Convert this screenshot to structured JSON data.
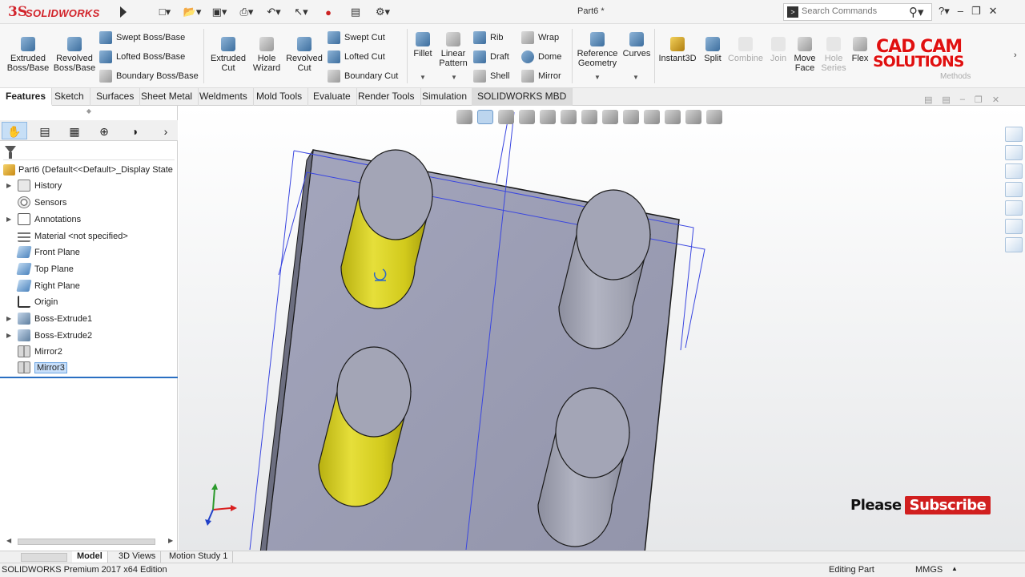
{
  "app": {
    "brand": "SOLIDWORKS",
    "doc_title": "Part6 *",
    "search_placeholder": "Search Commands"
  },
  "ribbon": {
    "big_buttons": [
      {
        "id": "extruded-boss",
        "label": "Extruded Boss/Base"
      },
      {
        "id": "revolved-boss",
        "label": "Revolved Boss/Base"
      },
      {
        "id": "extruded-cut",
        "label": "Extruded Cut"
      },
      {
        "id": "hole-wizard",
        "label": "Hole Wizard"
      },
      {
        "id": "revolved-cut",
        "label": "Revolved Cut"
      },
      {
        "id": "fillet",
        "label": "Fillet"
      },
      {
        "id": "linear-pattern",
        "label": "Linear Pattern"
      },
      {
        "id": "reference-geometry",
        "label": "Reference Geometry"
      },
      {
        "id": "curves",
        "label": "Curves"
      },
      {
        "id": "instant3d",
        "label": "Instant3D"
      },
      {
        "id": "split",
        "label": "Split"
      },
      {
        "id": "combine",
        "label": "Combine"
      },
      {
        "id": "join",
        "label": "Join"
      },
      {
        "id": "move-face",
        "label": "Move Face"
      },
      {
        "id": "hole-series",
        "label": "Hole Series"
      },
      {
        "id": "flex",
        "label": "Flex"
      }
    ],
    "small_buttons": [
      {
        "id": "swept-boss",
        "label": "Swept Boss/Base"
      },
      {
        "id": "lofted-boss",
        "label": "Lofted Boss/Base"
      },
      {
        "id": "boundary-boss",
        "label": "Boundary Boss/Base"
      },
      {
        "id": "swept-cut",
        "label": "Swept Cut"
      },
      {
        "id": "lofted-cut",
        "label": "Lofted Cut"
      },
      {
        "id": "boundary-cut",
        "label": "Boundary Cut"
      },
      {
        "id": "rib",
        "label": "Rib"
      },
      {
        "id": "draft",
        "label": "Draft"
      },
      {
        "id": "shell",
        "label": "Shell"
      },
      {
        "id": "wrap",
        "label": "Wrap"
      },
      {
        "id": "dome",
        "label": "Dome"
      },
      {
        "id": "mirror",
        "label": "Mirror"
      }
    ],
    "methods_label": "Methods"
  },
  "command_tabs": [
    "Features",
    "Sketch",
    "Surfaces",
    "Sheet Metal",
    "Weldments",
    "Mold Tools",
    "Evaluate",
    "Render Tools",
    "Simulation",
    "SOLIDWORKS MBD"
  ],
  "feature_tree": {
    "root": "Part6  (Default<<Default>_Display State",
    "items": [
      {
        "label": "History",
        "icon": "history-icon",
        "expandable": true
      },
      {
        "label": "Sensors",
        "icon": "sensors-icon",
        "expandable": false
      },
      {
        "label": "Annotations",
        "icon": "annotations-icon",
        "expandable": true
      },
      {
        "label": "Material <not specified>",
        "icon": "material-icon",
        "expandable": false
      },
      {
        "label": "Front Plane",
        "icon": "plane-icon",
        "expandable": false
      },
      {
        "label": "Top Plane",
        "icon": "plane-icon",
        "expandable": false
      },
      {
        "label": "Right Plane",
        "icon": "plane-icon",
        "expandable": false
      },
      {
        "label": "Origin",
        "icon": "origin-icon",
        "expandable": false
      },
      {
        "label": "Boss-Extrude1",
        "icon": "boss-extrude-icon",
        "expandable": true
      },
      {
        "label": "Boss-Extrude2",
        "icon": "boss-extrude-icon",
        "expandable": true
      },
      {
        "label": "Mirror2",
        "icon": "mirror-feature-icon",
        "expandable": false
      },
      {
        "label": "Mirror3",
        "icon": "mirror-feature-icon",
        "expandable": false,
        "selected": true
      }
    ]
  },
  "overlay": {
    "watermark_line1": "CAD CAM",
    "watermark_line2": "SOLUTIONS",
    "please": "Please",
    "subscribe": "Subscribe"
  },
  "bottom_tabs": [
    "Model",
    "3D Views",
    "Motion Study 1"
  ],
  "status": {
    "edition": "SOLIDWORKS Premium 2017 x64 Edition",
    "mode": "Editing Part",
    "units": "MMGS"
  },
  "colors": {
    "brand_red": "#d2232a",
    "plate": "#9a9cb3",
    "selected_cylinder": "#d6cf1e",
    "cylinder_gray": "#a3a5b4",
    "plane_outline": "#3a46e0",
    "selection_blue": "#2a6fc2"
  }
}
